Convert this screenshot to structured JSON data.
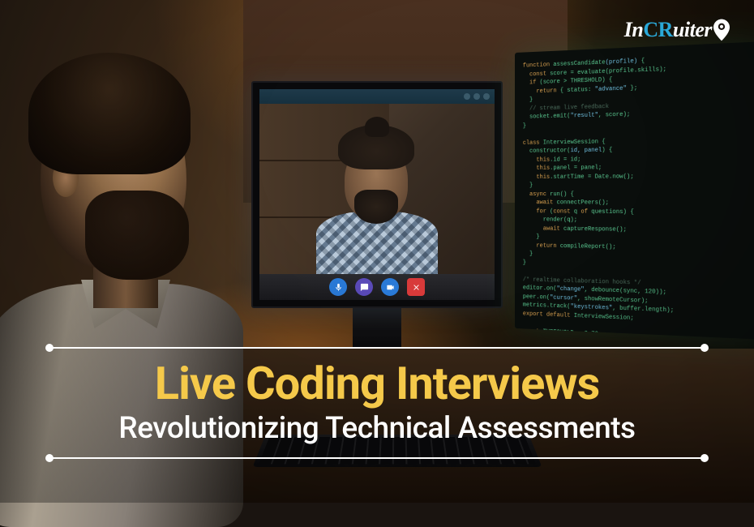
{
  "brand": {
    "name": "InCRuiter",
    "prefix": "In",
    "accent": "CR",
    "suffix": "uiter"
  },
  "headline": {
    "main": "Live Coding Interviews",
    "sub": "Revolutionizing Technical Assessments"
  },
  "video_call": {
    "toolbar": {
      "mic": "microphone-button",
      "chat": "chat-button",
      "camera": "camera-button",
      "end": "end-call-button"
    }
  },
  "colors": {
    "accent_yellow": "#f5c94a",
    "brand_blue": "#2aa8d8",
    "end_call_red": "#d83a3a"
  }
}
